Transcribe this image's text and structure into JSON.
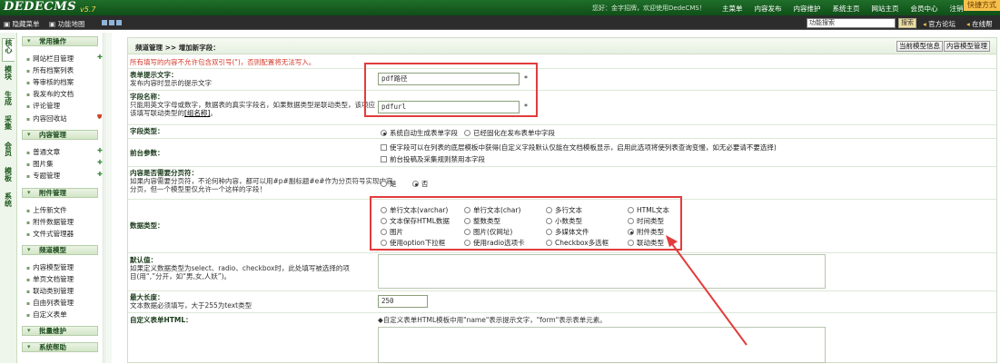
{
  "header": {
    "logo": "DEDECMS",
    "version": "v5.7",
    "welcome": "您好：金字招牌，欢迎使用DedeCMS！",
    "nav": [
      "主菜单",
      "内容发布",
      "内容维护",
      "系统主页",
      "网站主页",
      "会员中心",
      "注销"
    ],
    "quick_button": "快捷方式"
  },
  "subbar": {
    "item1": "隐藏菜单",
    "item2": "功能地图",
    "search_value": "功能搜索",
    "search_button": "搜索",
    "forum": "官方论坛",
    "online": "在线帮"
  },
  "vtabs": [
    "核心",
    "模块",
    "生成",
    "采集",
    "会员",
    "模板",
    "系统"
  ],
  "sidebar": {
    "sections": [
      {
        "title": "常用操作",
        "items": [
          "网站栏目管理",
          "所有档案列表",
          "等审核的档案",
          "我发布的文档",
          "评论管理",
          "内容回收站"
        ]
      },
      {
        "title": "内容管理",
        "items": [
          "普通文章",
          "图片集",
          "专题管理"
        ]
      },
      {
        "title": "附件管理",
        "items": [
          "上传新文件",
          "附件数据管理",
          "文件式管理器"
        ]
      },
      {
        "title": "频道模型",
        "items": [
          "内容模型管理",
          "单页文档管理",
          "联动类别管理",
          "自由列表管理",
          "自定义表单"
        ]
      },
      {
        "title": "批量维护",
        "items": []
      },
      {
        "title": "系统帮助",
        "items": []
      }
    ]
  },
  "main": {
    "breadcrumb": "频道管理 >> 增加新字段：",
    "btn_model_info": "当前模型信息",
    "btn_model_manage": "内容模型管理",
    "notice": "所有填写的内容不允许包含双引号(\")，否则配置将无法写入。",
    "form_label": {
      "title": "表单提示文字：",
      "desc": "发布内容时显示的提示文字",
      "value": "pdf路径"
    },
    "field_name": {
      "title": "字段名称：",
      "desc1": "只能用英文字母或数字，数据表的真实字段名，如果数据类型是联动类型，该项应",
      "desc2": "该填写联动类型的",
      "link": "[组名称]",
      "desc_end": "。",
      "value": "pdfurl"
    },
    "field_type": {
      "title": "字段类型：",
      "opt1": "系统自动生成表单字段",
      "opt2": "已经固化在发布表单中字段"
    },
    "frontend": {
      "title": "前台参数：",
      "opt1": "使字段可以在列表的底层模板中获得(自定义字段默认仅能在文档模板显示，启用此选项将使列表查询变慢，如无必要请不要选择)",
      "opt2": "前台投稿及采集规则禁用本字段"
    },
    "paging": {
      "title": "内容是否需要分页符：",
      "desc1": "如果内容需要分页符，不论何种内容，都可以用#p#副标题#e#作为分页符号实现内容",
      "desc2": "分页，但一个模型里仅允许一个这样的字段！",
      "yes": "是",
      "no": "否"
    },
    "data_type": {
      "title": "数据类型：",
      "options": [
        [
          "单行文本(varchar)",
          "单行文本(char)",
          "多行文本",
          "HTML文本"
        ],
        [
          "文本保存HTML数据",
          "整数类型",
          "小数类型",
          "时间类型"
        ],
        [
          "图片",
          "图片(仅网址)",
          "多媒体文件",
          "附件类型"
        ],
        [
          "使用option下拉框",
          "使用radio选项卡",
          "Checkbox多选框",
          "联动类型"
        ]
      ],
      "selected": "附件类型"
    },
    "default_value": {
      "title": "默认值：",
      "desc1": "如果定义数据类型为select、radio、checkbox时，此处填写被选择的项",
      "desc2": "目(用“,”分开，如“男,女,人妖”)。"
    },
    "max_length": {
      "title": "最大长度：",
      "desc": "文本数据必须填写，大于255为text类型",
      "value": "250"
    },
    "custom_html": {
      "title": "自定义表单HTML：",
      "hint": "◆自定义表单HTML模板中用\"name\"表示提示文字，\"form\"表示表单元素。"
    }
  }
}
